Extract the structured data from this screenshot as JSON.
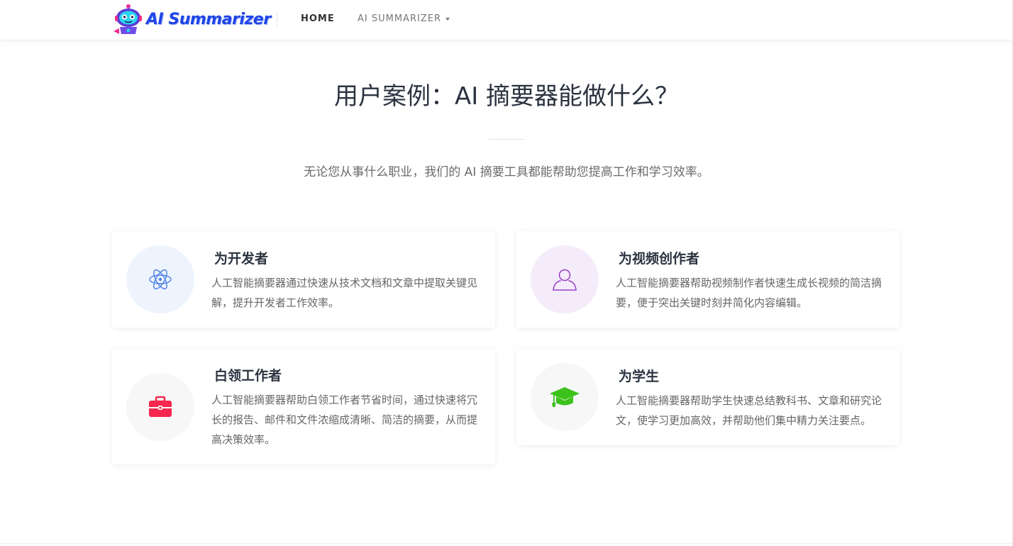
{
  "header": {
    "logo_text": "AI Summarizer",
    "nav": {
      "home_label": "HOME",
      "ai_label": "AI SUMMARIZER"
    }
  },
  "hero": {
    "title": "用户案例：AI 摘要器能做什么？",
    "subtitle": "无论您从事什么职业，我们的 AI 摘要工具都能帮助您提高工作和学习效率。"
  },
  "cards": [
    {
      "title": "为开发者",
      "description": "人工智能摘要器通过快速从技术文档和文章中提取关键见解，提升开发者工作效率。",
      "icon": "atom-icon",
      "icon_color": "#4a7fe6",
      "bg_color": "#eef4fd"
    },
    {
      "title": "为视频创作者",
      "description": "人工智能摘要器帮助视频制作者快速生成长视频的简洁摘要，便于突出关键时刻并简化内容编辑。",
      "icon": "user-icon",
      "icon_color": "#9b3ec6",
      "bg_color": "#f5ecfb"
    },
    {
      "title": "白领工作者",
      "description": "人工智能摘要器帮助白领工作者节省时间，通过快速将冗长的报告、邮件和文件浓缩成清晰、简洁的摘要，从而提高决策效率。",
      "icon": "briefcase-icon",
      "icon_color": "#f5274e",
      "bg_color": "#f6f7f6"
    },
    {
      "title": "为学生",
      "description": "人工智能摘要器帮助学生快速总结教科书、文章和研究论文，使学习更加高效，并帮助他们集中精力关注要点。",
      "icon": "graduation-cap-icon",
      "icon_color": "#3cc21a",
      "bg_color": "#f6f7f6"
    }
  ]
}
